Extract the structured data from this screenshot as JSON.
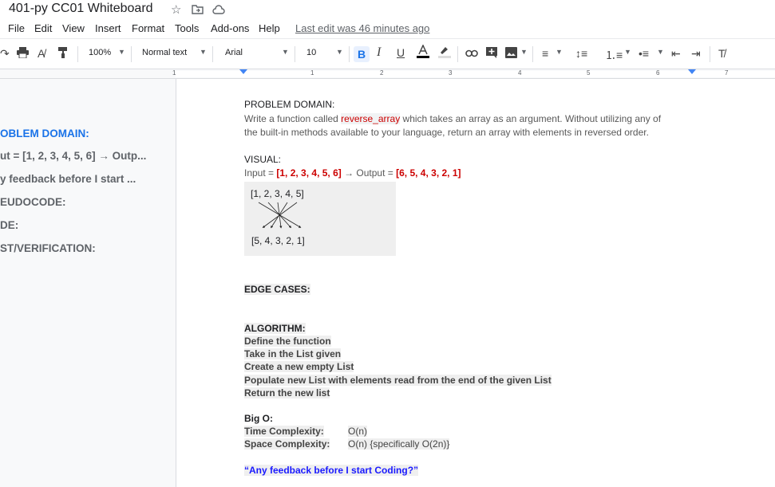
{
  "title_bar": {
    "doc_title": "401-py CC01 Whiteboard"
  },
  "menu": {
    "items": [
      "File",
      "Edit",
      "View",
      "Insert",
      "Format",
      "Tools",
      "Add-ons",
      "Help"
    ],
    "last_edit": "Last edit was 46 minutes ago"
  },
  "toolbar": {
    "zoom": "100%",
    "style": "Normal text",
    "font": "Arial",
    "font_size": "10"
  },
  "ruler": {
    "numbers": [
      "1",
      "1",
      "2",
      "3",
      "4",
      "5",
      "6",
      "7"
    ]
  },
  "outline": {
    "items": [
      "OBLEM DOMAIN:",
      "ut = [1, 2, 3, 4, 5, 6] → Outp...",
      "y feedback before I start ...",
      "EUDOCODE:",
      "DE:",
      "ST/VERIFICATION:"
    ]
  },
  "doc": {
    "problem_heading": "PROBLEM DOMAIN:",
    "problem_line1_pre": "Write a function called ",
    "problem_fn": "reverse_array",
    "problem_line1_post": " which takes an array as an argument. Without utilizing any of",
    "problem_line2": "the built-in methods available to your language, return an array with elements in reversed order.",
    "visual_heading": "VISUAL:",
    "visual_input_pre": "Input = ",
    "visual_input": "[1, 2, 3, 4, 5, 6]",
    "visual_arrow": " → Output = ",
    "visual_output": "[6, 5, 4, 3, 2, 1]",
    "diagram_top": "[1, 2, 3, 4, 5]",
    "diagram_bottom": "[5, 4, 3, 2, 1]",
    "edge_heading": "EDGE CASES:",
    "algorithm_heading": "ALGORITHM:",
    "algorithm_steps": [
      "Define the function",
      "Take in the List given",
      "Create a new empty List",
      "Populate new List with elements read from the end of the given List",
      "Return the new list"
    ],
    "bigo_heading": "Big O:",
    "time_label": "Time Complexity:",
    "time_value": "O(n)",
    "space_label": "Space Complexity:",
    "space_value": "O(n) {specifically O(2n)}",
    "feedback_question": "“Any feedback before I start Coding?”"
  }
}
